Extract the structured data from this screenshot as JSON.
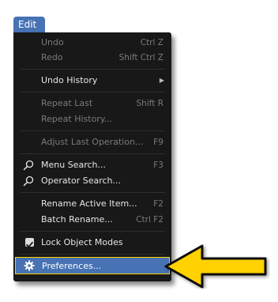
{
  "menu_tab": {
    "label": "Edit"
  },
  "items": [
    {
      "label": "Undo",
      "shortcut": "Ctrl Z"
    },
    {
      "label": "Redo",
      "shortcut": "Shift Ctrl Z"
    },
    {
      "label": "Undo History"
    },
    {
      "label": "Repeat Last",
      "shortcut": "Shift R"
    },
    {
      "label": "Repeat History..."
    },
    {
      "label": "Adjust Last Operation...",
      "shortcut": "F9"
    },
    {
      "label": "Menu Search...",
      "shortcut": "F3"
    },
    {
      "label": "Operator Search..."
    },
    {
      "label": "Rename Active Item...",
      "shortcut": "F2"
    },
    {
      "label": "Batch Rename...",
      "shortcut": "Ctrl F2"
    },
    {
      "label": "Lock Object Modes",
      "checked": true
    },
    {
      "label": "Preferences..."
    }
  ],
  "colors": {
    "menu_background": "#181818",
    "highlight": "#4772b3",
    "arrow": "#ffd200",
    "disabled_text": "#7a7a7a"
  },
  "icons": [
    "search-icon",
    "checkbox-icon",
    "gear-icon",
    "submenu-arrow-icon",
    "pointer-arrow-icon"
  ]
}
